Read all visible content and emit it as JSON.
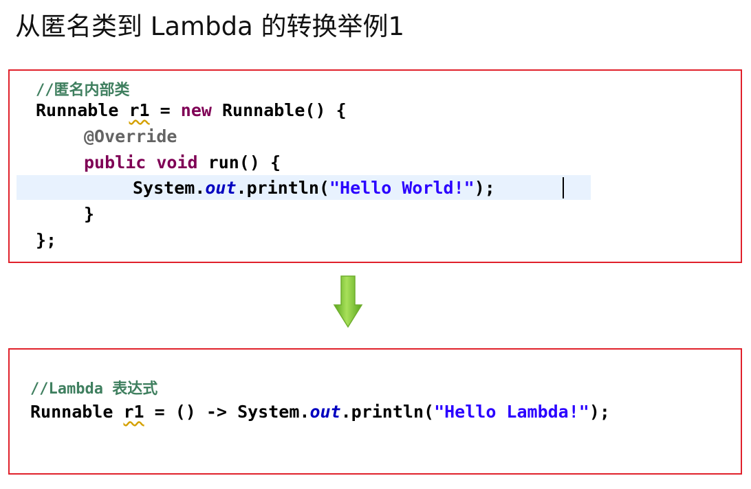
{
  "title": "从匿名类到 Lambda 的转换举例1",
  "top_block": {
    "comment": "//匿名内部类",
    "line1": {
      "type": "Runnable",
      "var": "r1",
      "op": "=",
      "kw_new": "new",
      "ctor": "Runnable() {"
    },
    "line2": {
      "annotation": "@Override"
    },
    "line3": {
      "kw_public": "public",
      "kw_void": "void",
      "method": "run() {"
    },
    "line4": {
      "prefix": "System.",
      "field": "out",
      "call": ".println(",
      "string": "\"Hello World!\"",
      "end": ");"
    },
    "line5": "}",
    "line6": "};"
  },
  "bottom_block": {
    "comment": "//Lambda 表达式",
    "line1": {
      "type": "Runnable",
      "var": "r1",
      "rest": "= () -> System.",
      "field": "out",
      "call": ".println(",
      "string": "\"Hello Lambda!\"",
      "end": ");"
    }
  },
  "colors": {
    "box_border": "#e0202a",
    "comment": "#3f7f5f",
    "keyword": "#7f0055",
    "string": "#2a00ff",
    "arrow": "#7cc832"
  },
  "icons": {
    "arrow": "down-arrow-icon"
  }
}
